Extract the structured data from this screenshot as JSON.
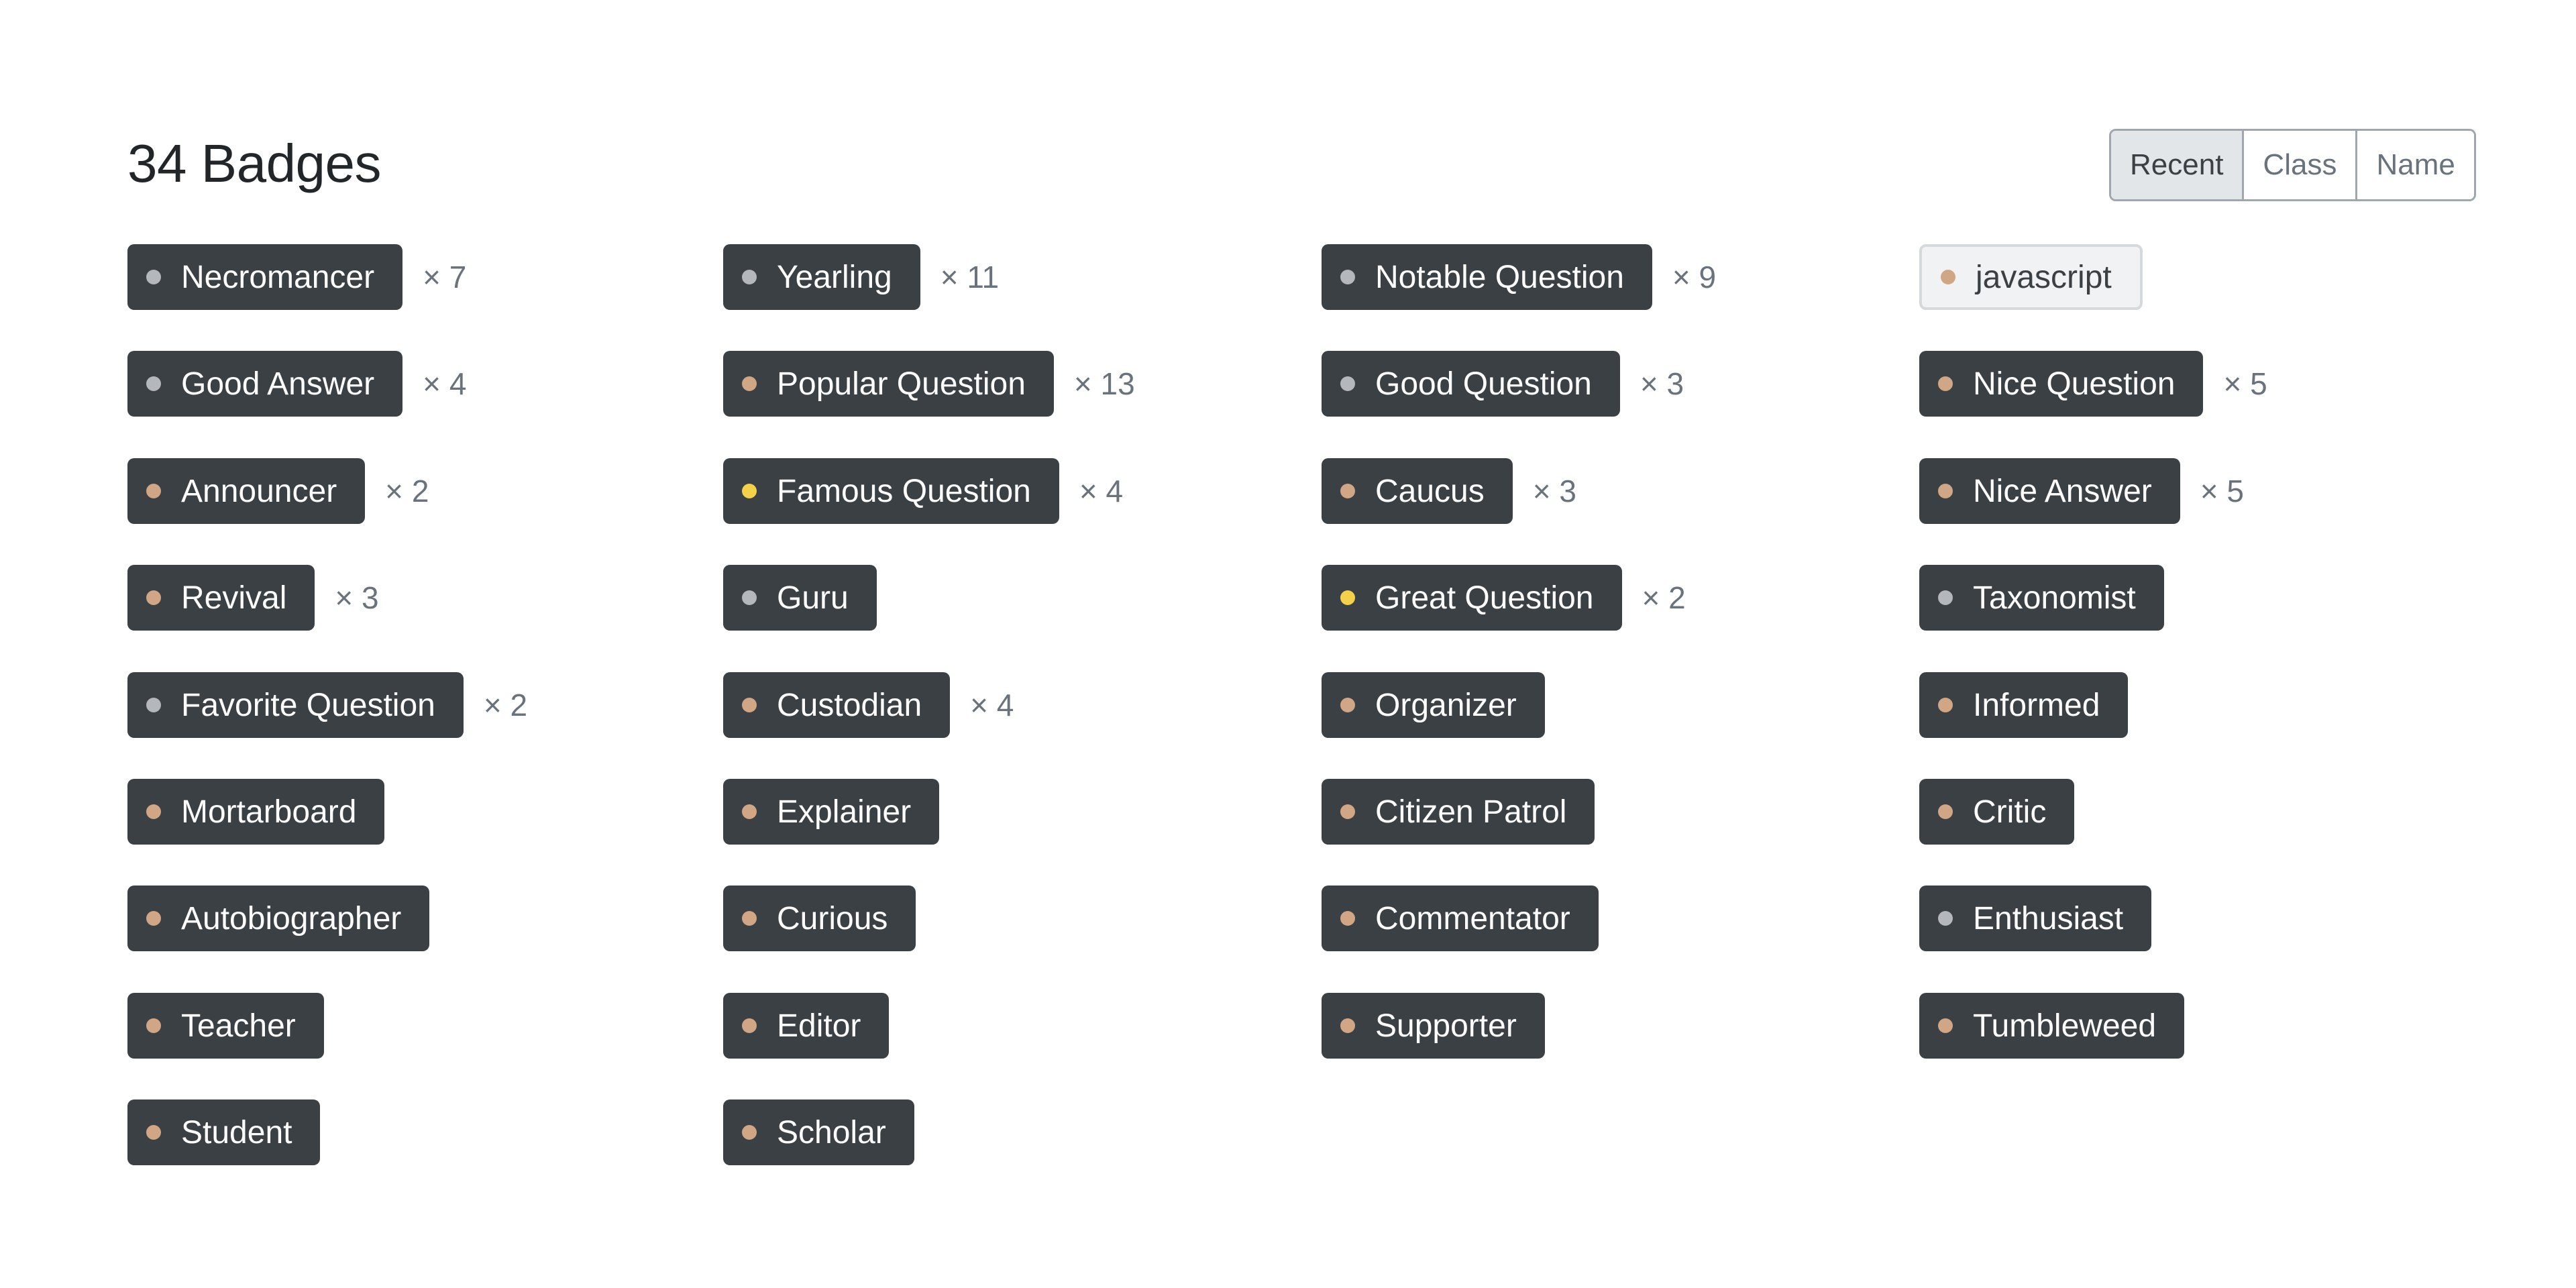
{
  "header": {
    "title": "34 Badges"
  },
  "sort": {
    "options": [
      {
        "label": "Recent",
        "active": true
      },
      {
        "label": "Class",
        "active": false
      },
      {
        "label": "Name",
        "active": false
      }
    ]
  },
  "colors": {
    "gold": "#f5d14a",
    "silver": "#b4b8bc",
    "bronze": "#d1a684",
    "badge_bg": "#3b4045"
  },
  "columns": [
    [
      {
        "name": "Necromancer",
        "class": "silver",
        "count": "× 7"
      },
      {
        "name": "Good Answer",
        "class": "silver",
        "count": "× 4"
      },
      {
        "name": "Announcer",
        "class": "bronze",
        "count": "× 2"
      },
      {
        "name": "Revival",
        "class": "bronze",
        "count": "× 3"
      },
      {
        "name": "Favorite Question",
        "class": "silver",
        "count": "× 2"
      },
      {
        "name": "Mortarboard",
        "class": "bronze",
        "count": ""
      },
      {
        "name": "Autobiographer",
        "class": "bronze",
        "count": ""
      },
      {
        "name": "Teacher",
        "class": "bronze",
        "count": ""
      },
      {
        "name": "Student",
        "class": "bronze",
        "count": ""
      }
    ],
    [
      {
        "name": "Yearling",
        "class": "silver",
        "count": "× 11"
      },
      {
        "name": "Popular Question",
        "class": "bronze",
        "count": "× 13"
      },
      {
        "name": "Famous Question",
        "class": "gold",
        "count": "× 4"
      },
      {
        "name": "Guru",
        "class": "silver",
        "count": ""
      },
      {
        "name": "Custodian",
        "class": "bronze",
        "count": "× 4"
      },
      {
        "name": "Explainer",
        "class": "bronze",
        "count": ""
      },
      {
        "name": "Curious",
        "class": "bronze",
        "count": ""
      },
      {
        "name": "Editor",
        "class": "bronze",
        "count": ""
      },
      {
        "name": "Scholar",
        "class": "bronze",
        "count": ""
      }
    ],
    [
      {
        "name": "Notable Question",
        "class": "silver",
        "count": "× 9"
      },
      {
        "name": "Good Question",
        "class": "silver",
        "count": "× 3"
      },
      {
        "name": "Caucus",
        "class": "bronze",
        "count": "× 3"
      },
      {
        "name": "Great Question",
        "class": "gold",
        "count": "× 2"
      },
      {
        "name": "Organizer",
        "class": "bronze",
        "count": ""
      },
      {
        "name": "Citizen Patrol",
        "class": "bronze",
        "count": ""
      },
      {
        "name": "Commentator",
        "class": "bronze",
        "count": ""
      },
      {
        "name": "Supporter",
        "class": "bronze",
        "count": ""
      }
    ],
    [
      {
        "name": "javascript",
        "class": "bronze",
        "count": "",
        "tag": true
      },
      {
        "name": "Nice Question",
        "class": "bronze",
        "count": "× 5"
      },
      {
        "name": "Nice Answer",
        "class": "bronze",
        "count": "× 5"
      },
      {
        "name": "Taxonomist",
        "class": "silver",
        "count": ""
      },
      {
        "name": "Informed",
        "class": "bronze",
        "count": ""
      },
      {
        "name": "Critic",
        "class": "bronze",
        "count": ""
      },
      {
        "name": "Enthusiast",
        "class": "silver",
        "count": ""
      },
      {
        "name": "Tumbleweed",
        "class": "bronze",
        "count": ""
      }
    ]
  ]
}
